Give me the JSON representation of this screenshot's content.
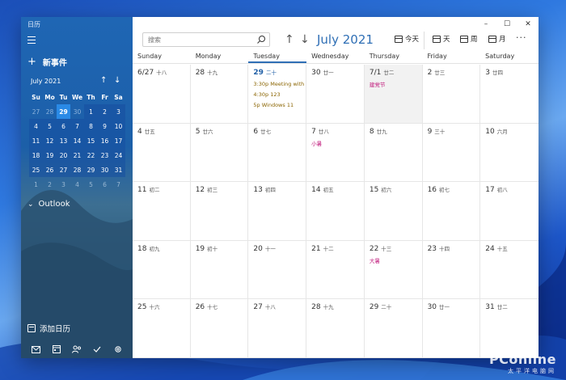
{
  "app": {
    "title": "日历",
    "new_event": "新事件",
    "mini_calendar": {
      "month": "July 2021",
      "dow": [
        "Su",
        "Mo",
        "Tu",
        "We",
        "Th",
        "Fr",
        "Sa"
      ],
      "days": [
        "27",
        "28",
        "29",
        "30",
        "1",
        "2",
        "3",
        "4",
        "5",
        "6",
        "7",
        "8",
        "9",
        "10",
        "11",
        "12",
        "13",
        "14",
        "15",
        "16",
        "17",
        "18",
        "19",
        "20",
        "21",
        "22",
        "23",
        "24",
        "25",
        "26",
        "27",
        "28",
        "29",
        "30",
        "31",
        "1",
        "2",
        "3",
        "4",
        "5",
        "6",
        "7"
      ]
    },
    "outlook": "Outlook",
    "add_calendar": "添加日历",
    "bottom_icons": [
      "mail-icon",
      "calendar-icon",
      "people-icon",
      "todo-icon",
      "settings-icon"
    ]
  },
  "toolbar": {
    "search_placeholder": "搜索",
    "month_title": "July 2021",
    "today_label": "今天",
    "day_label": "天",
    "week_label": "周",
    "month_label": "月",
    "more": "···"
  },
  "window_controls": {
    "minimize": "–",
    "maximize": "☐",
    "close": "✕"
  },
  "calendar": {
    "headers": [
      "Sunday",
      "Monday",
      "Tuesday",
      "Wednesday",
      "Thursday",
      "Friday",
      "Saturday"
    ],
    "weeks": [
      [
        {
          "day": "6/27",
          "lunar": "十八"
        },
        {
          "day": "28",
          "lunar": "十九"
        },
        {
          "day": "29",
          "lunar": "二十",
          "events": [
            "3:30p Meeting with",
            "4:30p 123",
            "5p Windows 11"
          ]
        },
        {
          "day": "30",
          "lunar": "廿一"
        },
        {
          "day": "7/1",
          "lunar": "廿二",
          "holiday": "建党节"
        },
        {
          "day": "2",
          "lunar": "廿三"
        },
        {
          "day": "3",
          "lunar": "廿四"
        }
      ],
      [
        {
          "day": "4",
          "lunar": "廿五"
        },
        {
          "day": "5",
          "lunar": "廿六"
        },
        {
          "day": "6",
          "lunar": "廿七"
        },
        {
          "day": "7",
          "lunar": "廿八",
          "holiday": "小暑"
        },
        {
          "day": "8",
          "lunar": "廿九"
        },
        {
          "day": "9",
          "lunar": "三十"
        },
        {
          "day": "10",
          "lunar": "六月"
        }
      ],
      [
        {
          "day": "11",
          "lunar": "初二"
        },
        {
          "day": "12",
          "lunar": "初三"
        },
        {
          "day": "13",
          "lunar": "初四"
        },
        {
          "day": "14",
          "lunar": "初五"
        },
        {
          "day": "15",
          "lunar": "初六"
        },
        {
          "day": "16",
          "lunar": "初七"
        },
        {
          "day": "17",
          "lunar": "初八"
        }
      ],
      [
        {
          "day": "18",
          "lunar": "初九"
        },
        {
          "day": "19",
          "lunar": "初十"
        },
        {
          "day": "20",
          "lunar": "十一"
        },
        {
          "day": "21",
          "lunar": "十二"
        },
        {
          "day": "22",
          "lunar": "十三",
          "holiday": "大暑"
        },
        {
          "day": "23",
          "lunar": "十四"
        },
        {
          "day": "24",
          "lunar": "十五"
        }
      ],
      [
        {
          "day": "25",
          "lunar": "十六"
        },
        {
          "day": "26",
          "lunar": "十七"
        },
        {
          "day": "27",
          "lunar": "十八"
        },
        {
          "day": "28",
          "lunar": "十九"
        },
        {
          "day": "29",
          "lunar": "二十"
        },
        {
          "day": "30",
          "lunar": "廿一"
        },
        {
          "day": "31",
          "lunar": "廿二"
        }
      ]
    ]
  },
  "watermark": {
    "main": "PConline",
    "sub": "太平洋电脑网"
  }
}
